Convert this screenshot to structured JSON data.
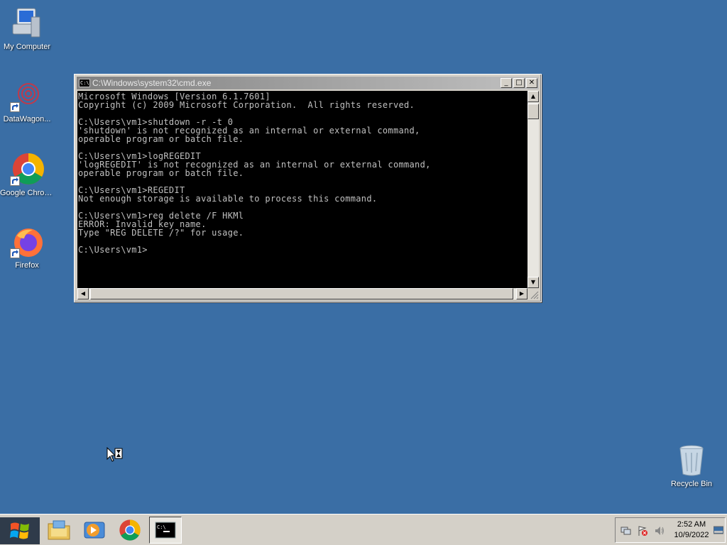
{
  "desktop": {
    "icons": [
      {
        "label": "My Computer",
        "icon": "computer-icon"
      },
      {
        "label": "DataWagon...",
        "icon": "datawagon-icon"
      },
      {
        "label": "Google Chrome",
        "icon": "chrome-icon"
      },
      {
        "label": "Firefox",
        "icon": "firefox-icon"
      },
      {
        "label": "Recycle Bin",
        "icon": "recycle-bin-icon"
      }
    ]
  },
  "cmd": {
    "title": "C:\\Windows\\system32\\cmd.exe",
    "minimize": "_",
    "maximize": "□",
    "close": "✕",
    "lines": [
      "Microsoft Windows [Version 6.1.7601]",
      "Copyright (c) 2009 Microsoft Corporation.  All rights reserved.",
      "",
      "C:\\Users\\vm1>shutdown -r -t 0",
      "'shutdown' is not recognized as an internal or external command,",
      "operable program or batch file.",
      "",
      "C:\\Users\\vm1>logREGEDIT",
      "'logREGEDIT' is not recognized as an internal or external command,",
      "operable program or batch file.",
      "",
      "C:\\Users\\vm1>REGEDIT",
      "Not enough storage is available to process this command.",
      "",
      "C:\\Users\\vm1>reg delete /F HKMl",
      "ERROR: Invalid key name.",
      "Type \"REG DELETE /?\" for usage.",
      "",
      "C:\\Users\\vm1>"
    ]
  },
  "taskbar": {
    "apps": [
      "windows-explorer-icon",
      "media-player-icon",
      "chrome-icon",
      "cmd-icon"
    ],
    "clock": {
      "time": "2:52 AM",
      "date": "10/9/2022"
    }
  },
  "colors": {
    "desktop": "#3a6ea5",
    "console_bg": "#000000",
    "console_fg": "#c0c0c0"
  }
}
